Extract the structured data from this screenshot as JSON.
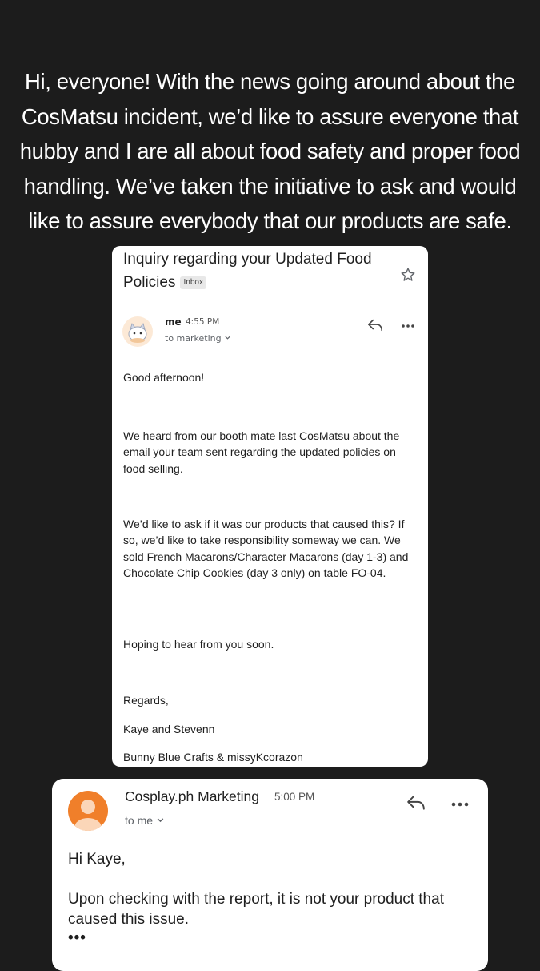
{
  "caption": "Hi, everyone! With the news going around about the CosMatsu incident, we’d like to assure everyone that hubby and I are all about food safety and proper food handling. We’ve taken the initiative to ask and would like to assure everybody that our products are safe.",
  "email1": {
    "subject": "Inquiry regarding your Updated Food Policies",
    "label": "Inbox",
    "sender": "me",
    "time": "4:55 PM",
    "to": "to marketing",
    "greeting": "Good afternoon!",
    "para1": "We heard from our booth mate last CosMatsu about the email your team sent regarding the updated policies on food selling.",
    "para2": "We’d like to ask if it was our products that caused this? If so, we’d like to take responsibility someway we can. We sold French Macarons/Character Macarons (day 1-3) and Chocolate Chip Cookies (day 3 only) on table FO-04.",
    "para3": "Hoping to hear from you soon.",
    "regards": "Regards,",
    "names": "Kaye and Stevenn",
    "brands": "Bunny Blue Crafts & missyKcorazon"
  },
  "email2": {
    "sender": "Cosplay.ph Marketing",
    "time": "5:00 PM",
    "to": "to me",
    "greeting": "Hi Kaye,",
    "message": "Upon checking with the report, it is not your product that caused this issue.",
    "ellipsis": "•••"
  },
  "icons": {
    "star": "star-icon",
    "reply": "reply-icon",
    "more": "more-horizontal-icon",
    "chevron": "chevron-down-icon"
  },
  "colors": {
    "background": "#1c1c1c",
    "card": "#ffffff",
    "avatar2": "#f07f2a"
  }
}
